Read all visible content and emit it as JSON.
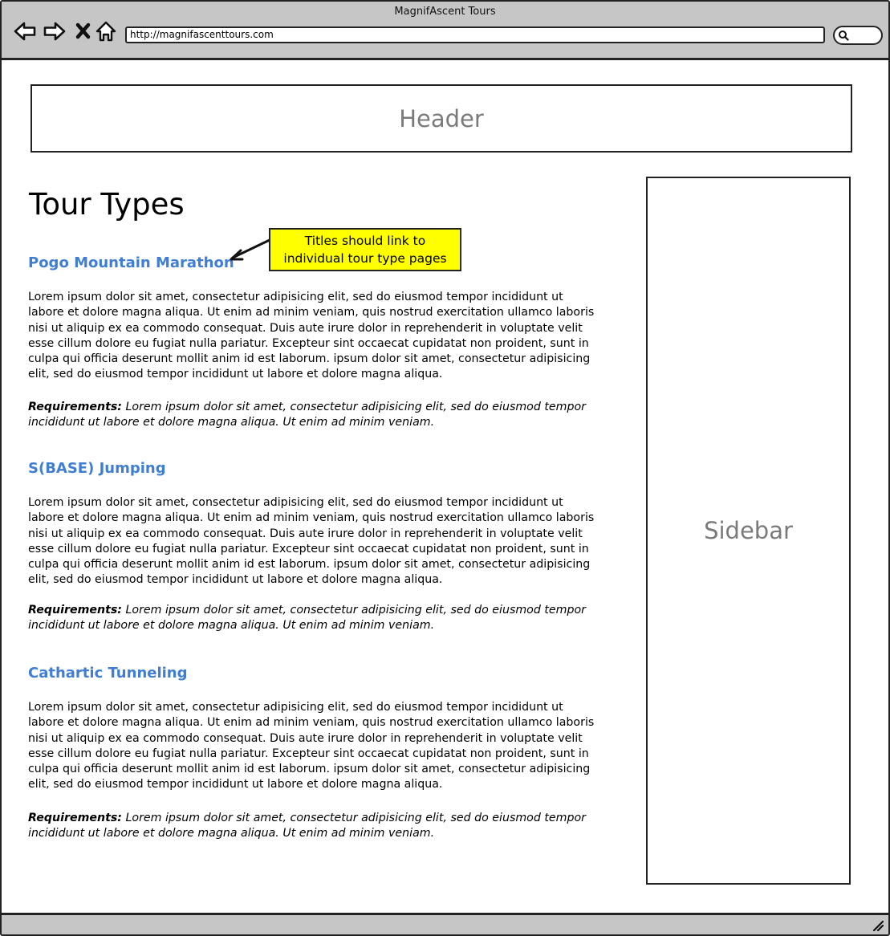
{
  "window": {
    "title": "MagnifAscent Tours",
    "url": "http://magnifascenttours.com"
  },
  "icons": {
    "back": "back-arrow-icon",
    "forward": "forward-arrow-icon",
    "stop": "close-icon",
    "home": "home-icon",
    "search": "search-icon"
  },
  "layout_labels": {
    "header": "Header",
    "sidebar": "Sidebar"
  },
  "page": {
    "title": "Tour Types"
  },
  "callout": {
    "line1": "Titles should link to",
    "line2": "individual tour type pages"
  },
  "tours": [
    {
      "title": "Pogo Mountain Marathon",
      "description": "Lorem ipsum dolor sit amet, consectetur adipisicing elit, sed do eiusmod tempor incididunt ut labore et dolore magna aliqua. Ut enim ad minim veniam, quis nostrud exercitation ullamco laboris nisi ut aliquip ex ea commodo consequat. Duis aute irure dolor in reprehenderit in voluptate velit esse cillum dolore eu fugiat nulla pariatur. Excepteur sint occaecat cupidatat non proident, sunt in culpa qui officia deserunt mollit anim id est laborum. ipsum dolor sit amet, consectetur adipisicing elit, sed do eiusmod tempor incididunt ut labore et dolore magna aliqua.",
      "requirements_label": "Requirements:",
      "requirements": " Lorem ipsum dolor sit amet, consectetur adipisicing elit, sed do eiusmod tempor incididunt ut labore et dolore magna aliqua. Ut enim ad minim veniam."
    },
    {
      "title": "S(BASE) Jumping",
      "description": "Lorem ipsum dolor sit amet, consectetur adipisicing elit, sed do eiusmod tempor incididunt ut labore et dolore magna aliqua. Ut enim ad minim veniam, quis nostrud exercitation ullamco laboris nisi ut aliquip ex ea commodo consequat. Duis aute irure dolor in reprehenderit in voluptate velit esse cillum dolore eu fugiat nulla pariatur. Excepteur sint occaecat cupidatat non proident, sunt in culpa qui officia deserunt mollit anim id est laborum. ipsum dolor sit amet, consectetur adipisicing elit, sed do eiusmod tempor incididunt ut labore et dolore magna aliqua.",
      "requirements_label": "Requirements:",
      "requirements": " Lorem ipsum dolor sit amet, consectetur adipisicing elit, sed do eiusmod tempor incididunt ut labore et dolore magna aliqua. Ut enim ad minim veniam."
    },
    {
      "title": "Cathartic Tunneling",
      "description": "Lorem ipsum dolor sit amet, consectetur adipisicing elit, sed do eiusmod tempor incididunt ut labore et dolore magna aliqua. Ut enim ad minim veniam, quis nostrud exercitation ullamco laboris nisi ut aliquip ex ea commodo consequat. Duis aute irure dolor in reprehenderit in voluptate velit esse cillum dolore eu fugiat nulla pariatur. Excepteur sint occaecat cupidatat non proident, sunt in culpa qui officia deserunt mollit anim id est laborum. ipsum dolor sit amet, consectetur adipisicing elit, sed do eiusmod tempor incididunt ut labore et dolore magna aliqua.",
      "requirements_label": "Requirements:",
      "requirements": " Lorem ipsum dolor sit amet, consectetur adipisicing elit, sed do eiusmod tempor incididunt ut labore et dolore magna aliqua. Ut enim ad minim veniam."
    }
  ],
  "colors": {
    "link": "#3f7ed2",
    "callout_bg": "#ffff00",
    "chrome": "#c6c6c6",
    "placeholder_text": "#7a7a7a"
  }
}
